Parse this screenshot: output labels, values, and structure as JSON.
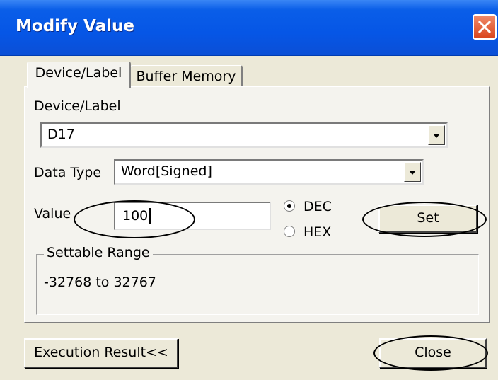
{
  "window": {
    "title": "Modify Value"
  },
  "tabs": [
    {
      "label": "Device/Label",
      "active": true
    },
    {
      "label": "Buffer Memory",
      "active": false
    }
  ],
  "device_label": {
    "label": "Device/Label",
    "value": "D17"
  },
  "data_type": {
    "label": "Data Type",
    "value": "Word[Signed]"
  },
  "value": {
    "label": "Value",
    "value": "100"
  },
  "radix": {
    "options": [
      {
        "label": "DEC",
        "selected": true
      },
      {
        "label": "HEX",
        "selected": false
      }
    ]
  },
  "set_button": {
    "label": "Set"
  },
  "settable_range": {
    "title": "Settable Range",
    "text": "-32768 to 32767"
  },
  "execution_result_button": {
    "label": "Execution Result<<"
  },
  "close_button": {
    "label": "Close"
  },
  "colors": {
    "titlebar": "#0656e6",
    "window_bg": "#ece9d8",
    "close_x": "#d9451c"
  }
}
